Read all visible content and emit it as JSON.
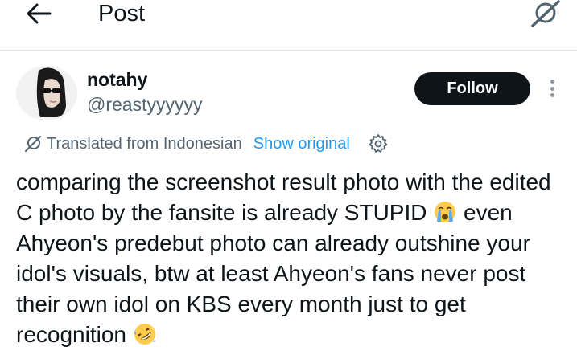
{
  "header": {
    "title": "Post",
    "icons": {
      "back": "arrow-left-icon",
      "translate": "grok-icon"
    }
  },
  "author": {
    "display_name": "notahy",
    "handle": "@reastyyyyyy",
    "avatar": "avatar-photo"
  },
  "actions": {
    "follow_label": "Follow",
    "more": "more-vertical-icon"
  },
  "translation": {
    "label": "Translated from Indonesian",
    "show_original": "Show original",
    "icon": "translate-icon",
    "settings_icon": "gear-icon"
  },
  "tweet": {
    "part1": "comparing the screenshot result photo with the edited C photo by the fansite is already STUPID ",
    "part2": " even Ahyeon's predebut photo can already outshine your idol's visuals, btw at least Ahyeon's fans never post their own idol on KBS every month just to get recognition ",
    "emoji1": "loudly-crying-face-emoji",
    "emoji2": "rolling-on-floor-laughing-emoji"
  },
  "colors": {
    "text": "#0f1419",
    "secondary": "#536471",
    "link": "#1d9bf0",
    "button_bg": "#0f1419",
    "button_text": "#ffffff"
  }
}
